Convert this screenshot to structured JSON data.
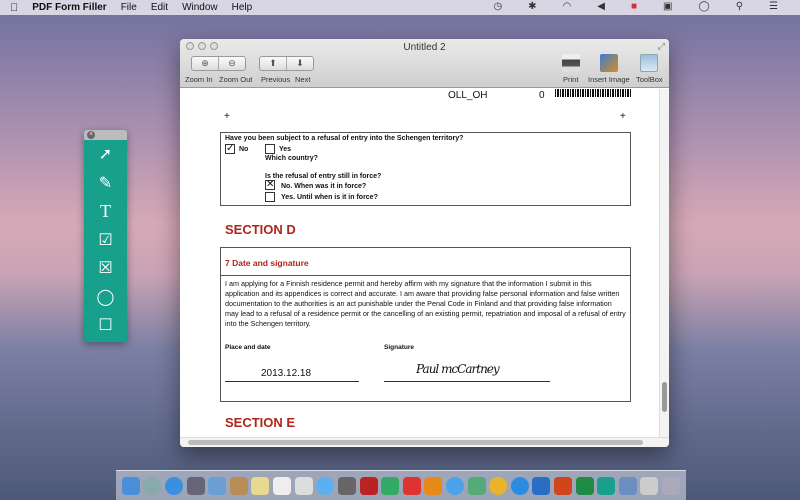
{
  "menubar": {
    "apple": "",
    "app": "PDF Form Filler",
    "items": [
      "File",
      "Edit",
      "Window",
      "Help"
    ],
    "status_icons": [
      "time-machine-icon",
      "bluetooth-icon",
      "wifi-icon",
      "volume-icon",
      "flag-icon",
      "display-icon",
      "clock-icon",
      "spotlight-icon",
      "notification-center-icon"
    ]
  },
  "window": {
    "title": "Untitled 2",
    "toolbar": {
      "zoom_in": "Zoom In",
      "zoom_out": "Zoom Out",
      "previous": "Previous",
      "next": "Next",
      "print": "Print",
      "insert_image": "Insert Image",
      "toolbox": "ToolBox"
    }
  },
  "doc": {
    "top_fragment": "OLL_OH",
    "top_digit": "0",
    "q_refusal": "Have you been subject to a refusal of entry into the Schengen territory?",
    "no": "No",
    "no_checked": true,
    "yes": "Yes",
    "yes_checked": false,
    "which_country": "Which country?",
    "q_in_force": "Is the refusal of entry still in force?",
    "opt_no": "No. When was it in force?",
    "opt_no_checked": true,
    "opt_yes": "Yes. Until when is it in force?",
    "opt_yes_checked": false,
    "section_d": "SECTION D",
    "sub7": "7  Date and signature",
    "declaration": "I am applying for a Finnish residence permit and hereby affirm with my signature that the information I submit in this application and its appendices is correct and accurate. I am aware that providing false personal information and false written documentation to the authorities is an act punishable under the Penal Code in Finland and that providing false information may lead to a refusal of a residence permit or the cancelling of an existing permit, repatriation and imposal of a refusal of entry into the Schengen territory.",
    "place_date_label": "Place and date",
    "place_date_value": "2013.12.18",
    "signature_label": "Signature",
    "signature_value": "Paul mcCartney",
    "section_e": "SECTION E"
  },
  "palette": {
    "tools": [
      "select-add-icon",
      "pen-icon",
      "text-icon",
      "checkmark-box-icon",
      "cross-box-icon",
      "circle-icon",
      "square-icon"
    ],
    "color": "#17a08c"
  },
  "colors": {
    "section_red": "#b0241c"
  }
}
